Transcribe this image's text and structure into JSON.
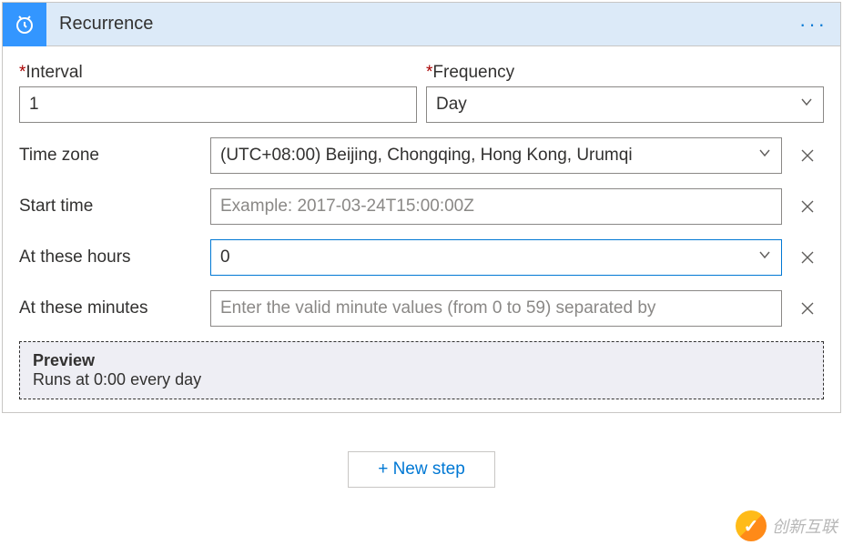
{
  "header": {
    "title": "Recurrence"
  },
  "topFields": {
    "intervalLabel": "Interval",
    "intervalValue": "1",
    "frequencyLabel": "Frequency",
    "frequencyValue": "Day"
  },
  "rows": {
    "timezoneLabel": "Time zone",
    "timezoneValue": "(UTC+08:00) Beijing, Chongqing, Hong Kong, Urumqi",
    "startTimeLabel": "Start time",
    "startTimePlaceholder": "Example: 2017-03-24T15:00:00Z",
    "hoursLabel": "At these hours",
    "hoursValue": "0",
    "minutesLabel": "At these minutes",
    "minutesPlaceholder": "Enter the valid minute values (from 0 to 59) separated by"
  },
  "preview": {
    "title": "Preview",
    "text": "Runs at 0:00 every day"
  },
  "footer": {
    "newStep": "New step"
  },
  "watermark": {
    "text": "创新互联"
  }
}
